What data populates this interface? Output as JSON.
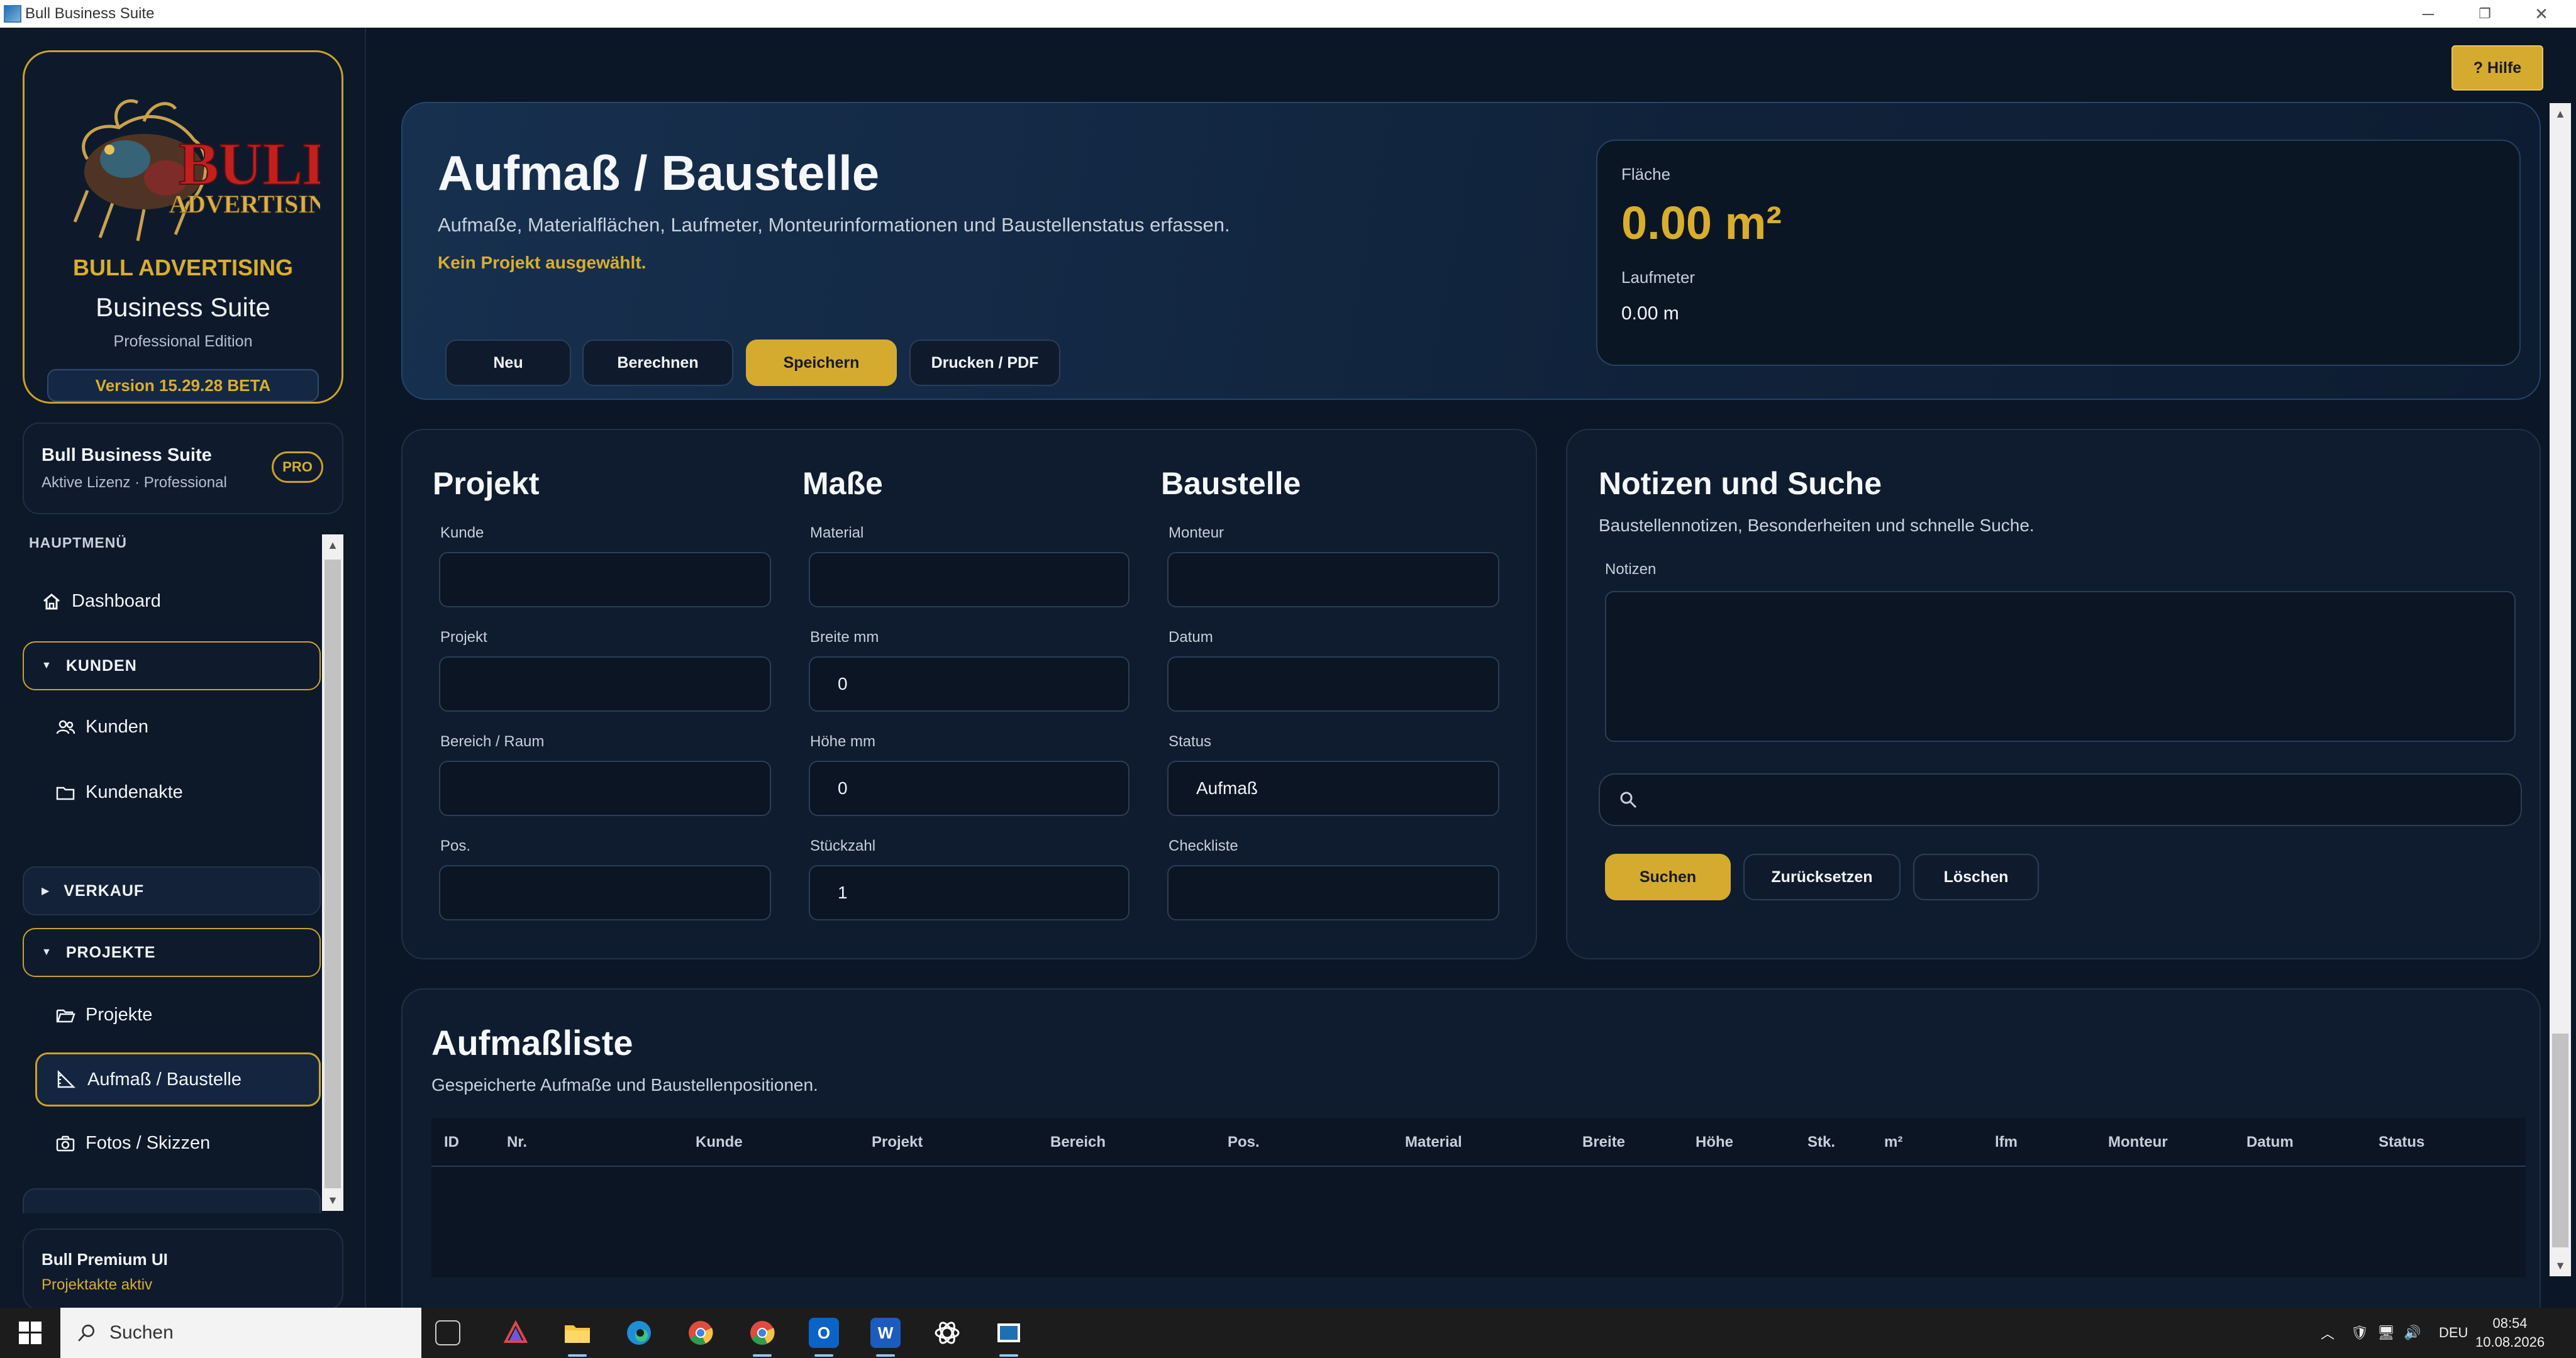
{
  "window": {
    "title": "Bull Business Suite"
  },
  "help": {
    "label": "? Hilfe"
  },
  "sidebar": {
    "brand": {
      "logo_text_top": "BULL",
      "logo_text_bottom": "ADVERTISING",
      "name": "BULL ADVERTISING",
      "suite": "Business Suite",
      "edition": "Professional Edition",
      "version": "Version 15.29.28 BETA"
    },
    "license": {
      "title": "Bull Business Suite",
      "subtitle": "Aktive Lizenz · Professional",
      "badge": "PRO"
    },
    "menu_heading": "HAUPTMENÜ",
    "items": {
      "dashboard": "Dashboard",
      "section_kunden": "KUNDEN",
      "kunden": "Kunden",
      "kundenakte": "Kundenakte",
      "section_verkauf": "VERKAUF",
      "section_projekte": "PROJEKTE",
      "projekte": "Projekte",
      "aufmass": "Aufmaß / Baustelle",
      "fotos": "Fotos / Skizzen"
    },
    "premium": {
      "title": "Bull Premium UI",
      "subtitle": "Projektakte aktiv"
    }
  },
  "hero": {
    "title": "Aufmaß / Baustelle",
    "subtitle": "Aufmaße, Materialflächen, Laufmeter, Monteurinformationen und Baustellenstatus erfassen.",
    "status": "Kein Projekt ausgewählt.",
    "buttons": {
      "new": "Neu",
      "calc": "Berechnen",
      "save": "Speichern",
      "print": "Drucken / PDF"
    },
    "metrics": {
      "area_label": "Fläche",
      "area_value": "0.00 m²",
      "lfm_label": "Laufmeter",
      "lfm_value": "0.00 m"
    }
  },
  "form": {
    "projekt": {
      "title": "Projekt",
      "kunde_label": "Kunde",
      "kunde_value": "",
      "projekt_label": "Projekt",
      "projekt_value": "",
      "bereich_label": "Bereich / Raum",
      "bereich_value": "",
      "pos_label": "Pos.",
      "pos_value": ""
    },
    "masse": {
      "title": "Maße",
      "material_label": "Material",
      "material_value": "",
      "breite_label": "Breite mm",
      "breite_value": "0",
      "hoehe_label": "Höhe mm",
      "hoehe_value": "0",
      "stueck_label": "Stückzahl",
      "stueck_value": "1"
    },
    "baustelle": {
      "title": "Baustelle",
      "monteur_label": "Monteur",
      "monteur_value": "",
      "datum_label": "Datum",
      "datum_value": "",
      "status_label": "Status",
      "status_value": "Aufmaß",
      "checkliste_label": "Checkliste",
      "checkliste_value": ""
    }
  },
  "notes": {
    "title": "Notizen und Suche",
    "subtitle": "Baustellennotizen, Besonderheiten und schnelle Suche.",
    "notes_label": "Notizen",
    "notes_value": "",
    "search_value": "",
    "buttons": {
      "search": "Suchen",
      "reset": "Zurücksetzen",
      "delete": "Löschen"
    }
  },
  "list": {
    "title": "Aufmaßliste",
    "subtitle": "Gespeicherte Aufmaße und Baustellenpositionen.",
    "columns": [
      "ID",
      "Nr.",
      "Kunde",
      "Projekt",
      "Bereich",
      "Pos.",
      "Material",
      "Breite",
      "Höhe",
      "Stk.",
      "m²",
      "lfm",
      "Monteur",
      "Datum",
      "Status"
    ],
    "rows": []
  },
  "taskbar": {
    "search_placeholder": "Suchen",
    "language": "DEU",
    "time": "08:54",
    "date": "10.08.2026"
  },
  "colors": {
    "accent_gold": "#d4ab2f",
    "background": "#0b1626",
    "panel": "#0f1c2f"
  }
}
